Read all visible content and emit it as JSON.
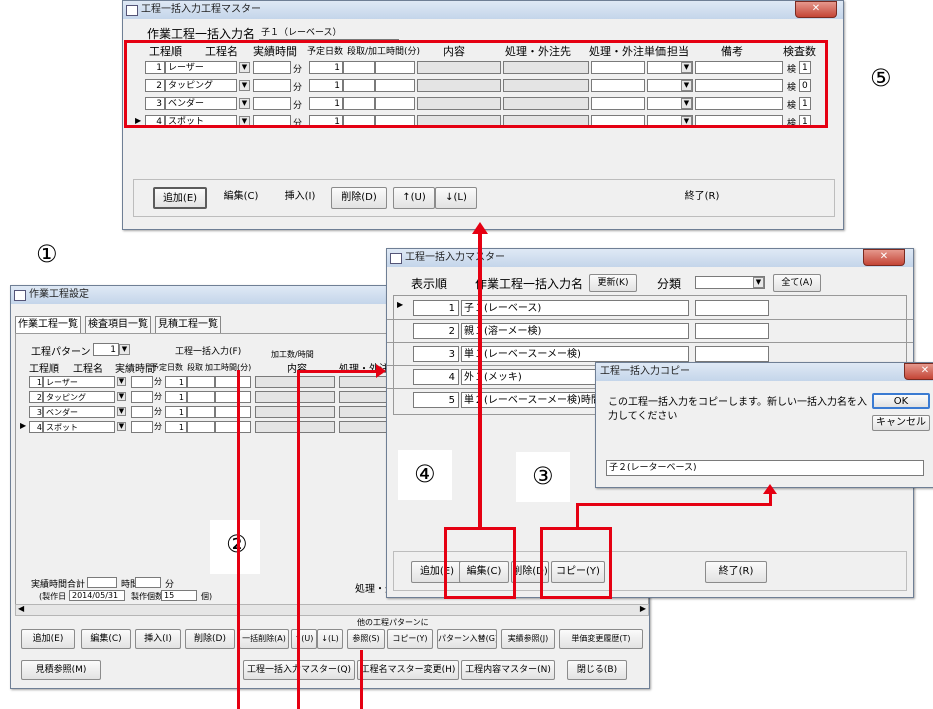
{
  "top_window": {
    "title": "工程一括入力工程マスター",
    "input_label": "作業工程一括入力名",
    "input_value": "子１（レーベース）",
    "headers": [
      "工程順",
      "工程名",
      "実績時間",
      "予定日数",
      "段取/加工時間(分)",
      "内容",
      "処理・外注先",
      "処理・外注単価",
      "担当",
      "備考",
      "検査数"
    ],
    "rows": [
      {
        "order": "1",
        "name": "レーザー",
        "unit": "分",
        "days": "1",
        "kensa": "検",
        "count": "1"
      },
      {
        "order": "2",
        "name": "タッピング",
        "unit": "分",
        "days": "1",
        "kensa": "検",
        "count": "0"
      },
      {
        "order": "3",
        "name": "ベンダー",
        "unit": "分",
        "days": "1",
        "kensa": "検",
        "count": "1"
      },
      {
        "order": "4",
        "name": "スポット",
        "unit": "分",
        "days": "1",
        "kensa": "検",
        "count": "1"
      }
    ],
    "buttons": [
      "追加(E)",
      "編集(C)",
      "挿入(I)",
      "削除(D)",
      "↑(U)",
      "↓(L)"
    ],
    "exit": "終了(R)"
  },
  "labels": {
    "n1": "①",
    "n2": "②",
    "n3": "③",
    "n4": "④",
    "n5": "⑤"
  },
  "main_window": {
    "title": "作業工程設定",
    "tabs": [
      "作業工程一覧",
      "検査項目一覧",
      "見積工程一覧"
    ],
    "pattern_label": "工程パターン",
    "pattern_value": "1",
    "bulk_label": "工程一括入力(F)",
    "kako_label": "加工数/時間",
    "headers": [
      "工程順",
      "工程名",
      "実績時間",
      "予定日数",
      "段取",
      "加工時間(分)",
      "内容",
      "処理・外注先"
    ],
    "rows": [
      {
        "order": "1",
        "name": "レーザー",
        "unit": "分",
        "days": "1"
      },
      {
        "order": "2",
        "name": "タッピング",
        "unit": "分",
        "days": "1"
      },
      {
        "order": "3",
        "name": "ベンダー",
        "unit": "分",
        "days": "1"
      },
      {
        "order": "4",
        "name": "スポット",
        "unit": "分",
        "days": "1"
      }
    ],
    "total_label": "実績時間合計",
    "hour_unit": "時間",
    "min_unit": "分",
    "shori_label": "処理・外",
    "created_label": "(製作日",
    "created_value": "2014/05/31",
    "qty_label": "製作個数",
    "qty_value": "15",
    "qty_unit": "個)",
    "other_pattern": "他の工程パターンに",
    "buttons_row1": [
      "追加(E)",
      "編集(C)",
      "挿入(I)",
      "削除(D)",
      "一括削除(A)",
      "↑(U)",
      "↓(L)",
      "参照(S)",
      "コピー(Y)",
      "パターン入替(G)",
      "実績参照(J)",
      "単価変更履歴(T)"
    ],
    "buttons_row2": [
      "見積参照(M)",
      "工程一括入力マスター(Q)",
      "工程名マスター変更(H)",
      "工程内容マスター(N)",
      "閉じる(B)"
    ]
  },
  "list_window": {
    "title": "工程一括入力マスター",
    "col_order": "表示順",
    "col_name": "作業工程一括入力名",
    "update_btn": "更新(K)",
    "class_label": "分類",
    "all_btn": "全て(A)",
    "rows": [
      {
        "order": "1",
        "name": "子１(レーベース)"
      },
      {
        "order": "2",
        "name": "親１(溶ーメー検)"
      },
      {
        "order": "3",
        "name": "単１(レーベースーメー検)"
      },
      {
        "order": "4",
        "name": "外１(メッキ)"
      },
      {
        "order": "5",
        "name": "単２(レーベースーメー検)時間ﾅｼ"
      }
    ],
    "buttons": [
      "追加(E)",
      "編集(C)",
      "削除(D)",
      "コピー(Y)"
    ],
    "exit": "終了(R)"
  },
  "copy_dialog": {
    "title": "工程一括入力コピー",
    "message1": "この工程一括入力をコピーします。新しい一括入力名を入",
    "message2": "力してください",
    "ok": "OK",
    "cancel": "キャンセル",
    "input_value": "子２(レーターベース)"
  }
}
